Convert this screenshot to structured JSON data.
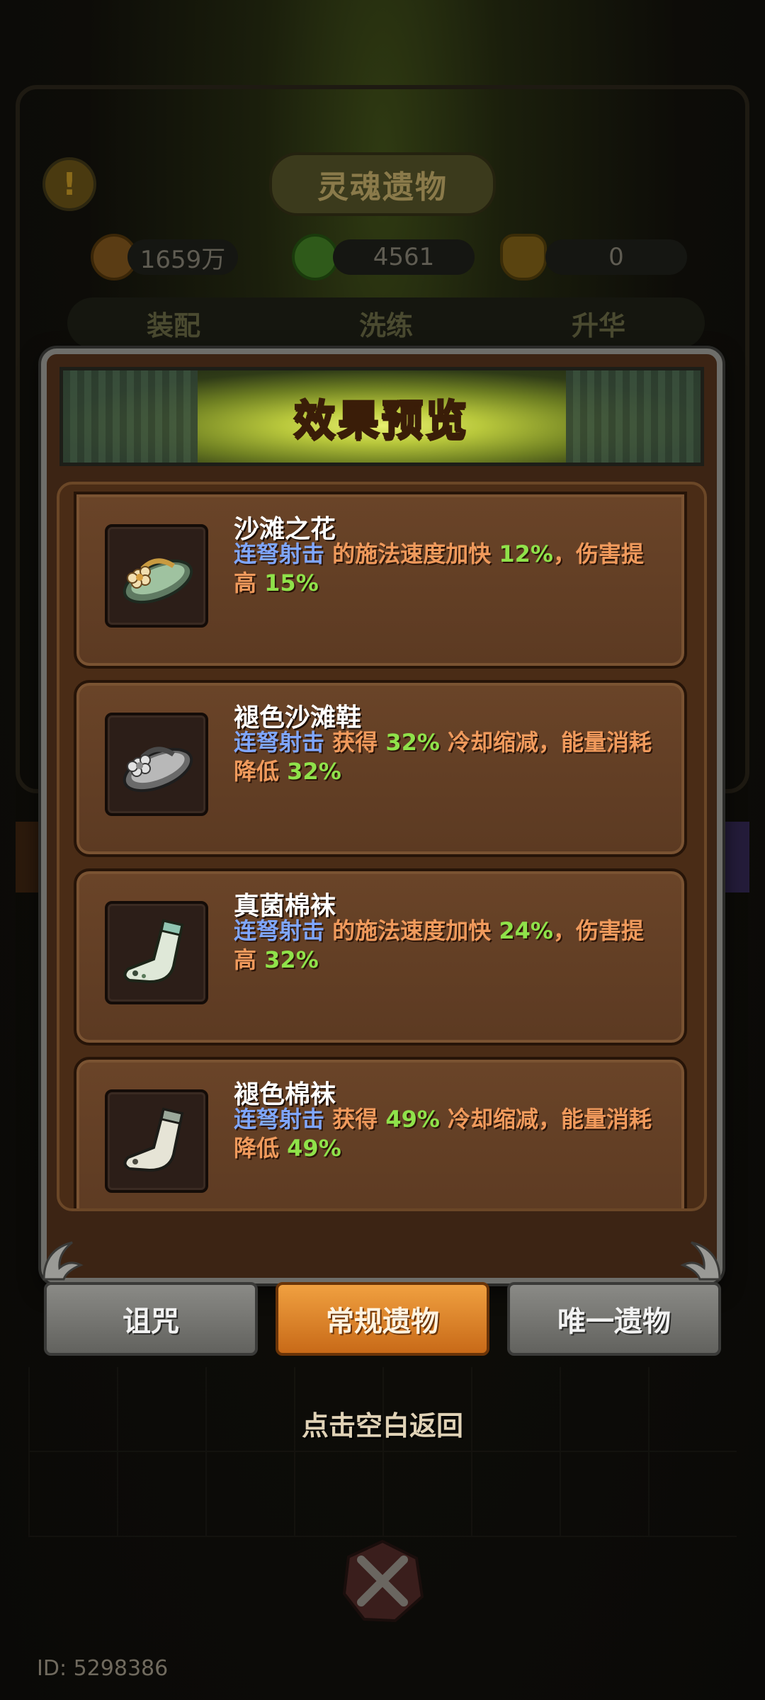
{
  "background": {
    "alert_symbol": "!",
    "title": "灵魂遗物",
    "resources": [
      {
        "icon": "coin-icon",
        "value": "1659万"
      },
      {
        "icon": "green-soul-icon",
        "value": "4561"
      },
      {
        "icon": "tooth-icon",
        "value": "0"
      }
    ],
    "tabs": [
      "装配",
      "洗练",
      "升华"
    ]
  },
  "modal": {
    "title": "效果预览",
    "items": [
      {
        "name": "沙滩之花",
        "icon": "flower-sandal-icon",
        "skill": "连弩射击",
        "desc_a": " 的施法速度加快 ",
        "val_a": "12%",
        "desc_b": "，伤害提高 ",
        "val_b": "15%",
        "desc_c": ""
      },
      {
        "name": "褪色沙滩鞋",
        "icon": "faded-sandal-icon",
        "skill": "连弩射击",
        "desc_a": " 获得 ",
        "val_a": "32%",
        "desc_b": " 冷却缩减，能量消耗降低 ",
        "val_b": "32%",
        "desc_c": ""
      },
      {
        "name": "真菌棉袜",
        "icon": "fungal-sock-icon",
        "skill": "连弩射击",
        "desc_a": " 的施法速度加快 ",
        "val_a": "24%",
        "desc_b": "，伤害提高 ",
        "val_b": "32%",
        "desc_c": ""
      },
      {
        "name": "褪色棉袜",
        "icon": "faded-sock-icon",
        "skill": "连弩射击",
        "desc_a": " 获得 ",
        "val_a": "49%",
        "desc_b": " 冷却缩减，能量消耗降低 ",
        "val_b": "49%",
        "desc_c": ""
      }
    ]
  },
  "tabs": {
    "curse": "诅咒",
    "regular": "常规遗物",
    "unique": "唯一遗物",
    "active": "regular"
  },
  "hint": "点击空白返回",
  "footer": {
    "id_text": "ID: 5298386"
  },
  "colors": {
    "skill_blue": "#7fa6ff",
    "value_green": "#8fe24a",
    "desc_orange": "#f09a5c",
    "title_gold": "#ffc21a",
    "active_tab": "#e08a2c"
  }
}
